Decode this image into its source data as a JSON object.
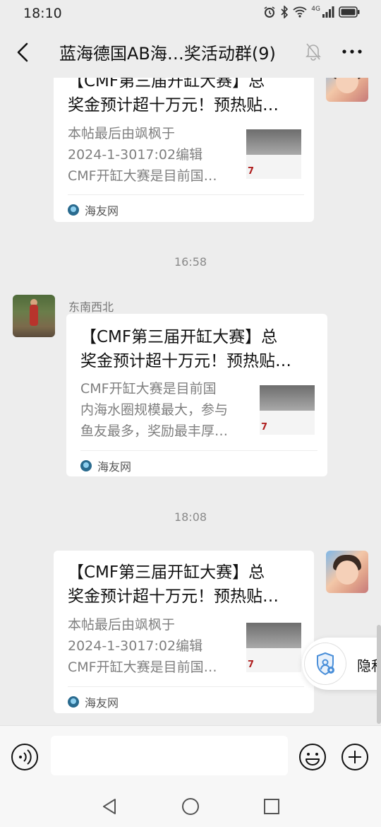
{
  "status_bar": {
    "time": "18:10",
    "icons": [
      "alarm-icon",
      "bluetooth-icon",
      "wifi-icon",
      "signal-icon",
      "battery-icon"
    ],
    "network_label": "4G"
  },
  "nav": {
    "title": "蓝海德国AB海…奖活动群(9)",
    "icons": [
      "back-icon",
      "mute-bell-icon",
      "more-icon"
    ]
  },
  "messages": [
    {
      "side": "right",
      "title": "【CMF第三届开缸大赛】总奖金预计超十万元！预热贴…",
      "desc": "本帖最后由飒枫于\n2024-1-3017:02编辑\nCMF开缸大赛是目前国…",
      "source": "海友网"
    },
    {
      "timestamp": "16:58"
    },
    {
      "side": "left",
      "sender": "东南西北",
      "title": "【CMF第三届开缸大赛】总奖金预计超十万元！预热贴…",
      "desc": "CMF开缸大赛是目前国\n内海水圈规模最大，参与\n鱼友最多，奖励最丰厚…",
      "source": "海友网"
    },
    {
      "timestamp": "18:08"
    },
    {
      "side": "right",
      "title": "【CMF第三届开缸大赛】总奖金预计超十万元！预热贴…",
      "desc": "本帖最后由飒枫于\n2024-1-3017:02编辑\nCMF开缸大赛是目前国…",
      "source": "海友网"
    }
  ],
  "card_lines": {
    "c1": {
      "t1": "【CMF第三届开缸大赛】总",
      "t2": "奖金预计超十万元！预热贴…",
      "d1": "本帖最后由飒枫于",
      "d2": "2024-1-3017:02编辑",
      "d3": "CMF开缸大赛是目前国…"
    },
    "c2": {
      "t1": "【CMF第三届开缸大赛】总",
      "t2": "奖金预计超十万元！预热贴…",
      "d1": "CMF开缸大赛是目前国",
      "d2": "内海水圈规模最大，参与",
      "d3": "鱼友最多，奖励最丰厚…"
    },
    "c3": {
      "t1": "【CMF第三届开缸大赛】总",
      "t2": "奖金预计超十万元！预热贴…",
      "d1": "本帖最后由飒枫于",
      "d2": "2024-1-3017:02编辑",
      "d3": "CMF开缸大赛是目前国…"
    },
    "thumb_text": "7"
  },
  "privacy_popup": {
    "label": "隐私"
  },
  "input_bar": {
    "placeholder": "",
    "icons": [
      "voice-icon",
      "emoji-icon",
      "plus-icon"
    ]
  },
  "system_nav": {
    "icons": [
      "nav-back-icon",
      "nav-home-icon",
      "nav-recents-icon"
    ]
  },
  "colors": {
    "background": "#ededed",
    "bubble": "#ffffff",
    "secondary_text": "#7f7f7f",
    "timestamp_text": "#8a8a8a",
    "privacy_icon": "#4a8fd9"
  }
}
